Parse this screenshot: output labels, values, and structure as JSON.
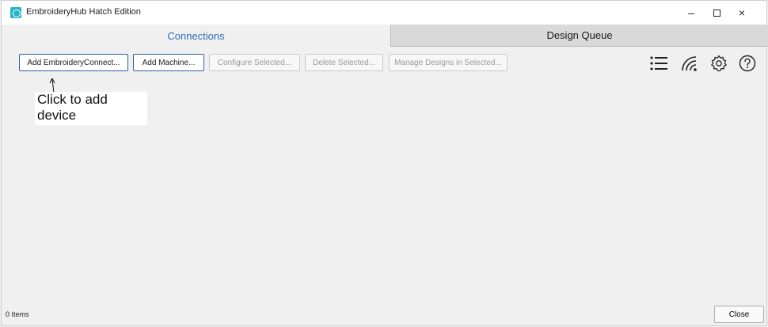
{
  "window": {
    "title": "EmbroideryHub Hatch Edition",
    "controls": {
      "minimize": "–",
      "close": "×"
    }
  },
  "tabs": [
    {
      "label": "Connections",
      "active": true
    },
    {
      "label": "Design Queue",
      "active": false
    }
  ],
  "toolbar": {
    "buttons": [
      {
        "label": "Add EmbroideryConnect...",
        "enabled": true
      },
      {
        "label": "Add Machine...",
        "enabled": true
      },
      {
        "label": "Configure Selected...",
        "enabled": false
      },
      {
        "label": "Delete Selected...",
        "enabled": false
      },
      {
        "label": "Manage Designs in Selected...",
        "enabled": false
      }
    ],
    "icons": [
      "list-icon",
      "wifi-icon",
      "gear-icon",
      "help-icon"
    ]
  },
  "annotation": {
    "line1": "Click to add",
    "line2": "device"
  },
  "status": {
    "items_count": "0 Items",
    "close_label": "Close"
  },
  "colors": {
    "active_tab_text": "#2e6fb5",
    "app_icon": "#2bb3c9",
    "primary_border": "#2e5fa8"
  }
}
